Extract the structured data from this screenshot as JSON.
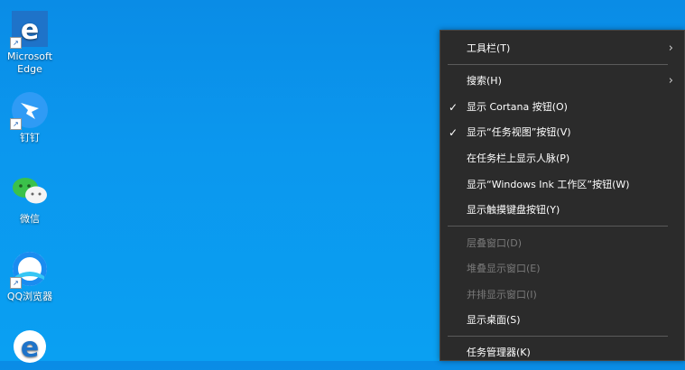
{
  "desktop": {
    "icons": [
      {
        "label": "Microsoft Edge"
      },
      {
        "label": "钉钉"
      },
      {
        "label": "微信"
      },
      {
        "label": "QQ浏览器"
      },
      {
        "label": ""
      }
    ]
  },
  "context_menu": {
    "items": [
      {
        "label": "工具栏(T)",
        "checked": false,
        "enabled": true,
        "submenu": true
      },
      {
        "label": "搜索(H)",
        "checked": false,
        "enabled": true,
        "submenu": true
      },
      {
        "label": "显示 Cortana 按钮(O)",
        "checked": true,
        "enabled": true,
        "submenu": false
      },
      {
        "label": "显示“任务视图”按钮(V)",
        "checked": true,
        "enabled": true,
        "submenu": false
      },
      {
        "label": "在任务栏上显示人脉(P)",
        "checked": false,
        "enabled": true,
        "submenu": false
      },
      {
        "label": "显示“Windows Ink 工作区”按钮(W)",
        "checked": false,
        "enabled": true,
        "submenu": false
      },
      {
        "label": "显示触摸键盘按钮(Y)",
        "checked": false,
        "enabled": true,
        "submenu": false
      },
      {
        "label": "层叠窗口(D)",
        "checked": false,
        "enabled": false,
        "submenu": false
      },
      {
        "label": "堆叠显示窗口(E)",
        "checked": false,
        "enabled": false,
        "submenu": false
      },
      {
        "label": "并排显示窗口(I)",
        "checked": false,
        "enabled": false,
        "submenu": false
      },
      {
        "label": "显示桌面(S)",
        "checked": false,
        "enabled": true,
        "submenu": false
      },
      {
        "label": "任务管理器(K)",
        "checked": false,
        "enabled": true,
        "submenu": false
      }
    ],
    "check_glyph": "✓",
    "submenu_glyph": "›"
  },
  "colors": {
    "desktop_bg": "#0b97ee",
    "menu_bg": "#2b2b2b",
    "menu_text": "#ffffff",
    "menu_disabled_text": "#7a7a7a"
  }
}
